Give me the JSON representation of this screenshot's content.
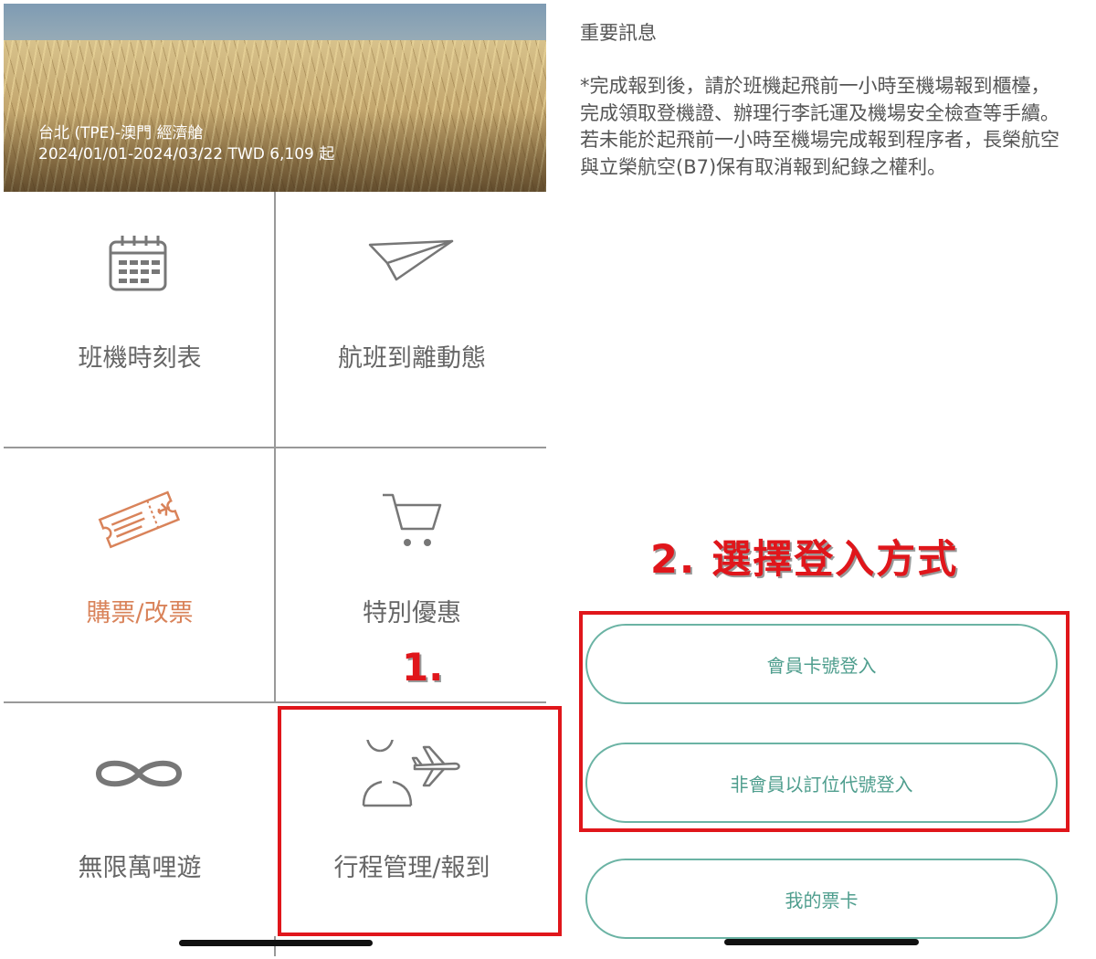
{
  "banner": {
    "route": "台北 (TPE)-澳門 經濟艙",
    "detail": "2024/01/01-2024/03/22 TWD 6,109 起"
  },
  "menu": {
    "items": [
      {
        "label": "班機時刻表",
        "icon": "calendar-icon"
      },
      {
        "label": "航班到離動態",
        "icon": "paper-plane-icon"
      },
      {
        "label": "購票/改票",
        "icon": "ticket-icon"
      },
      {
        "label": "特別優惠",
        "icon": "shopping-cart-icon"
      },
      {
        "label": "無限萬哩遊",
        "icon": "infinity-icon"
      },
      {
        "label": "行程管理/報到",
        "icon": "person-plane-icon"
      }
    ]
  },
  "annotations": {
    "step1": "1.",
    "step2": "2. 選擇登入方式"
  },
  "notice": {
    "title": "重要訊息",
    "body": "*完成報到後，請於班機起飛前一小時至機場報到櫃檯，完成領取登機證、辦理行李託運及機場安全檢查等手續。若未能於起飛前一小時至機場完成報到程序者，長榮航空與立榮航空(B7)保有取消報到紀錄之權利。"
  },
  "login": {
    "member_button": "會員卡號登入",
    "nonmember_button": "非會員以訂位代號登入",
    "ticket_card_button": "我的票卡"
  },
  "colors": {
    "accent_orange": "#d9835a",
    "teal": "#4f9e8e",
    "annotation_red": "#e0161b"
  }
}
